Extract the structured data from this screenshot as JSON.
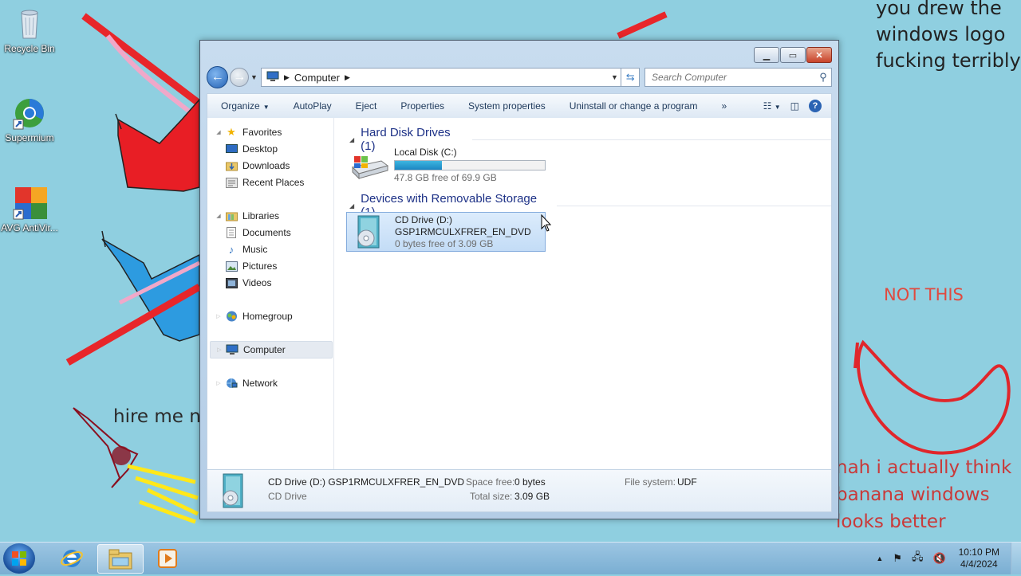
{
  "desktop": {
    "icons": [
      {
        "label": "Recycle Bin",
        "icon": "recycle-bin-icon"
      },
      {
        "label": "Supermium",
        "icon": "supermium-icon"
      },
      {
        "label": "AVG AntiVir...",
        "icon": "avg-antivirus-icon"
      }
    ],
    "notes": {
      "top": "you drew the windows logo fucking terribly",
      "not_this": "NOT THIS",
      "banana": "nah i actually think banana windows looks better",
      "hire": "hire me n"
    }
  },
  "window": {
    "nav": {
      "back_icon": "back-arrow-icon",
      "forward_icon": "forward-arrow-icon",
      "breadcrumb": [
        "Computer"
      ],
      "search_placeholder": "Search Computer"
    },
    "toolbar": {
      "organize": "Organize",
      "autoplay": "AutoPlay",
      "eject": "Eject",
      "properties": "Properties",
      "system_properties": "System properties",
      "uninstall": "Uninstall or change a program",
      "more": "»"
    },
    "navpane": {
      "favorites": "Favorites",
      "desktop": "Desktop",
      "downloads": "Downloads",
      "recent_places": "Recent Places",
      "libraries": "Libraries",
      "documents": "Documents",
      "music": "Music",
      "pictures": "Pictures",
      "videos": "Videos",
      "homegroup": "Homegroup",
      "computer": "Computer",
      "network": "Network"
    },
    "groups": {
      "hdd": {
        "header": "Hard Disk Drives (1)",
        "drive_name": "Local Disk (C:)",
        "free_text": "47.8 GB free of 69.9 GB",
        "used_fraction": 0.316
      },
      "removable": {
        "header": "Devices with Removable Storage (1)",
        "drive_name": "CD Drive (D:)",
        "volume_label": "GSP1RMCULXFRER_EN_DVD",
        "free_text": "0 bytes free of 3.09 GB"
      }
    },
    "details": {
      "title": "CD Drive (D:) GSP1RMCULXFRER_EN_DVD",
      "type": "CD Drive",
      "space_free_label": "Space free:",
      "space_free_value": "0 bytes",
      "total_size_label": "Total size:",
      "total_size_value": "3.09 GB",
      "file_system_label": "File system:",
      "file_system_value": "UDF"
    }
  },
  "taskbar": {
    "apps": [
      "internet-explorer-icon",
      "windows-explorer-icon",
      "media-player-icon"
    ],
    "time": "10:10 PM",
    "date": "4/4/2024"
  }
}
